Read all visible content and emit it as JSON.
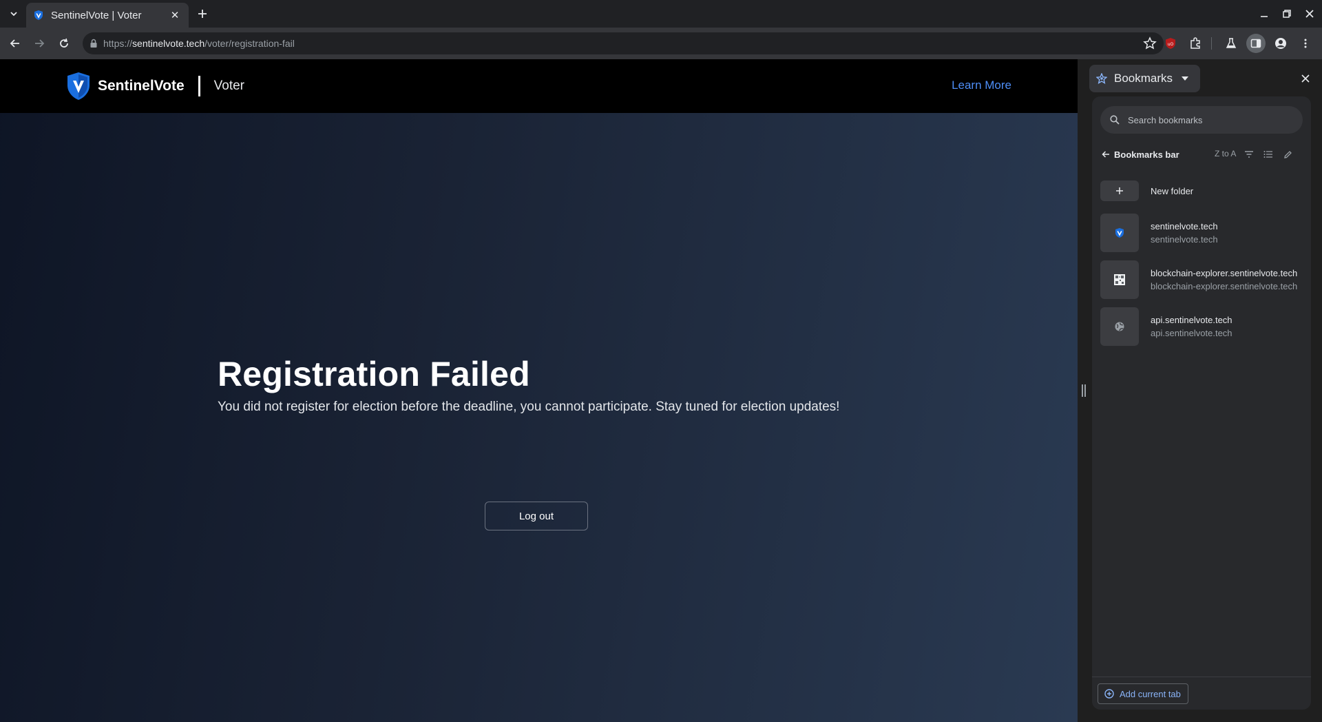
{
  "browser": {
    "tab": {
      "title": "SentinelVote | Voter"
    },
    "url": {
      "scheme": "https://",
      "host": "sentinelvote.tech",
      "path": "/voter/registration-fail"
    }
  },
  "site": {
    "brand_name": "SentinelVote",
    "role": "Voter",
    "nav_link": "Learn More",
    "brand_color": "#1a6fe0"
  },
  "main": {
    "headline": "Registration Failed",
    "message": "You did not register for election before the deadline, you cannot participate. Stay tuned for election updates!",
    "logout_label": "Log out"
  },
  "side_panel": {
    "title": "Bookmarks",
    "search_placeholder": "Search bookmarks",
    "folder_title": "Bookmarks bar",
    "sort_label": "Z to A",
    "new_folder_label": "New folder",
    "items": [
      {
        "name": "sentinelvote.tech",
        "url": "sentinelvote.tech",
        "icon": "sentinelvote-favicon-icon"
      },
      {
        "name": "blockchain-explorer.sentinelvote.tech",
        "url": "blockchain-explorer.sentinelvote.tech",
        "icon": "qr-favicon-icon"
      },
      {
        "name": "api.sentinelvote.tech",
        "url": "api.sentinelvote.tech",
        "icon": "globe-icon"
      }
    ],
    "add_current_tab_label": "Add current tab"
  }
}
